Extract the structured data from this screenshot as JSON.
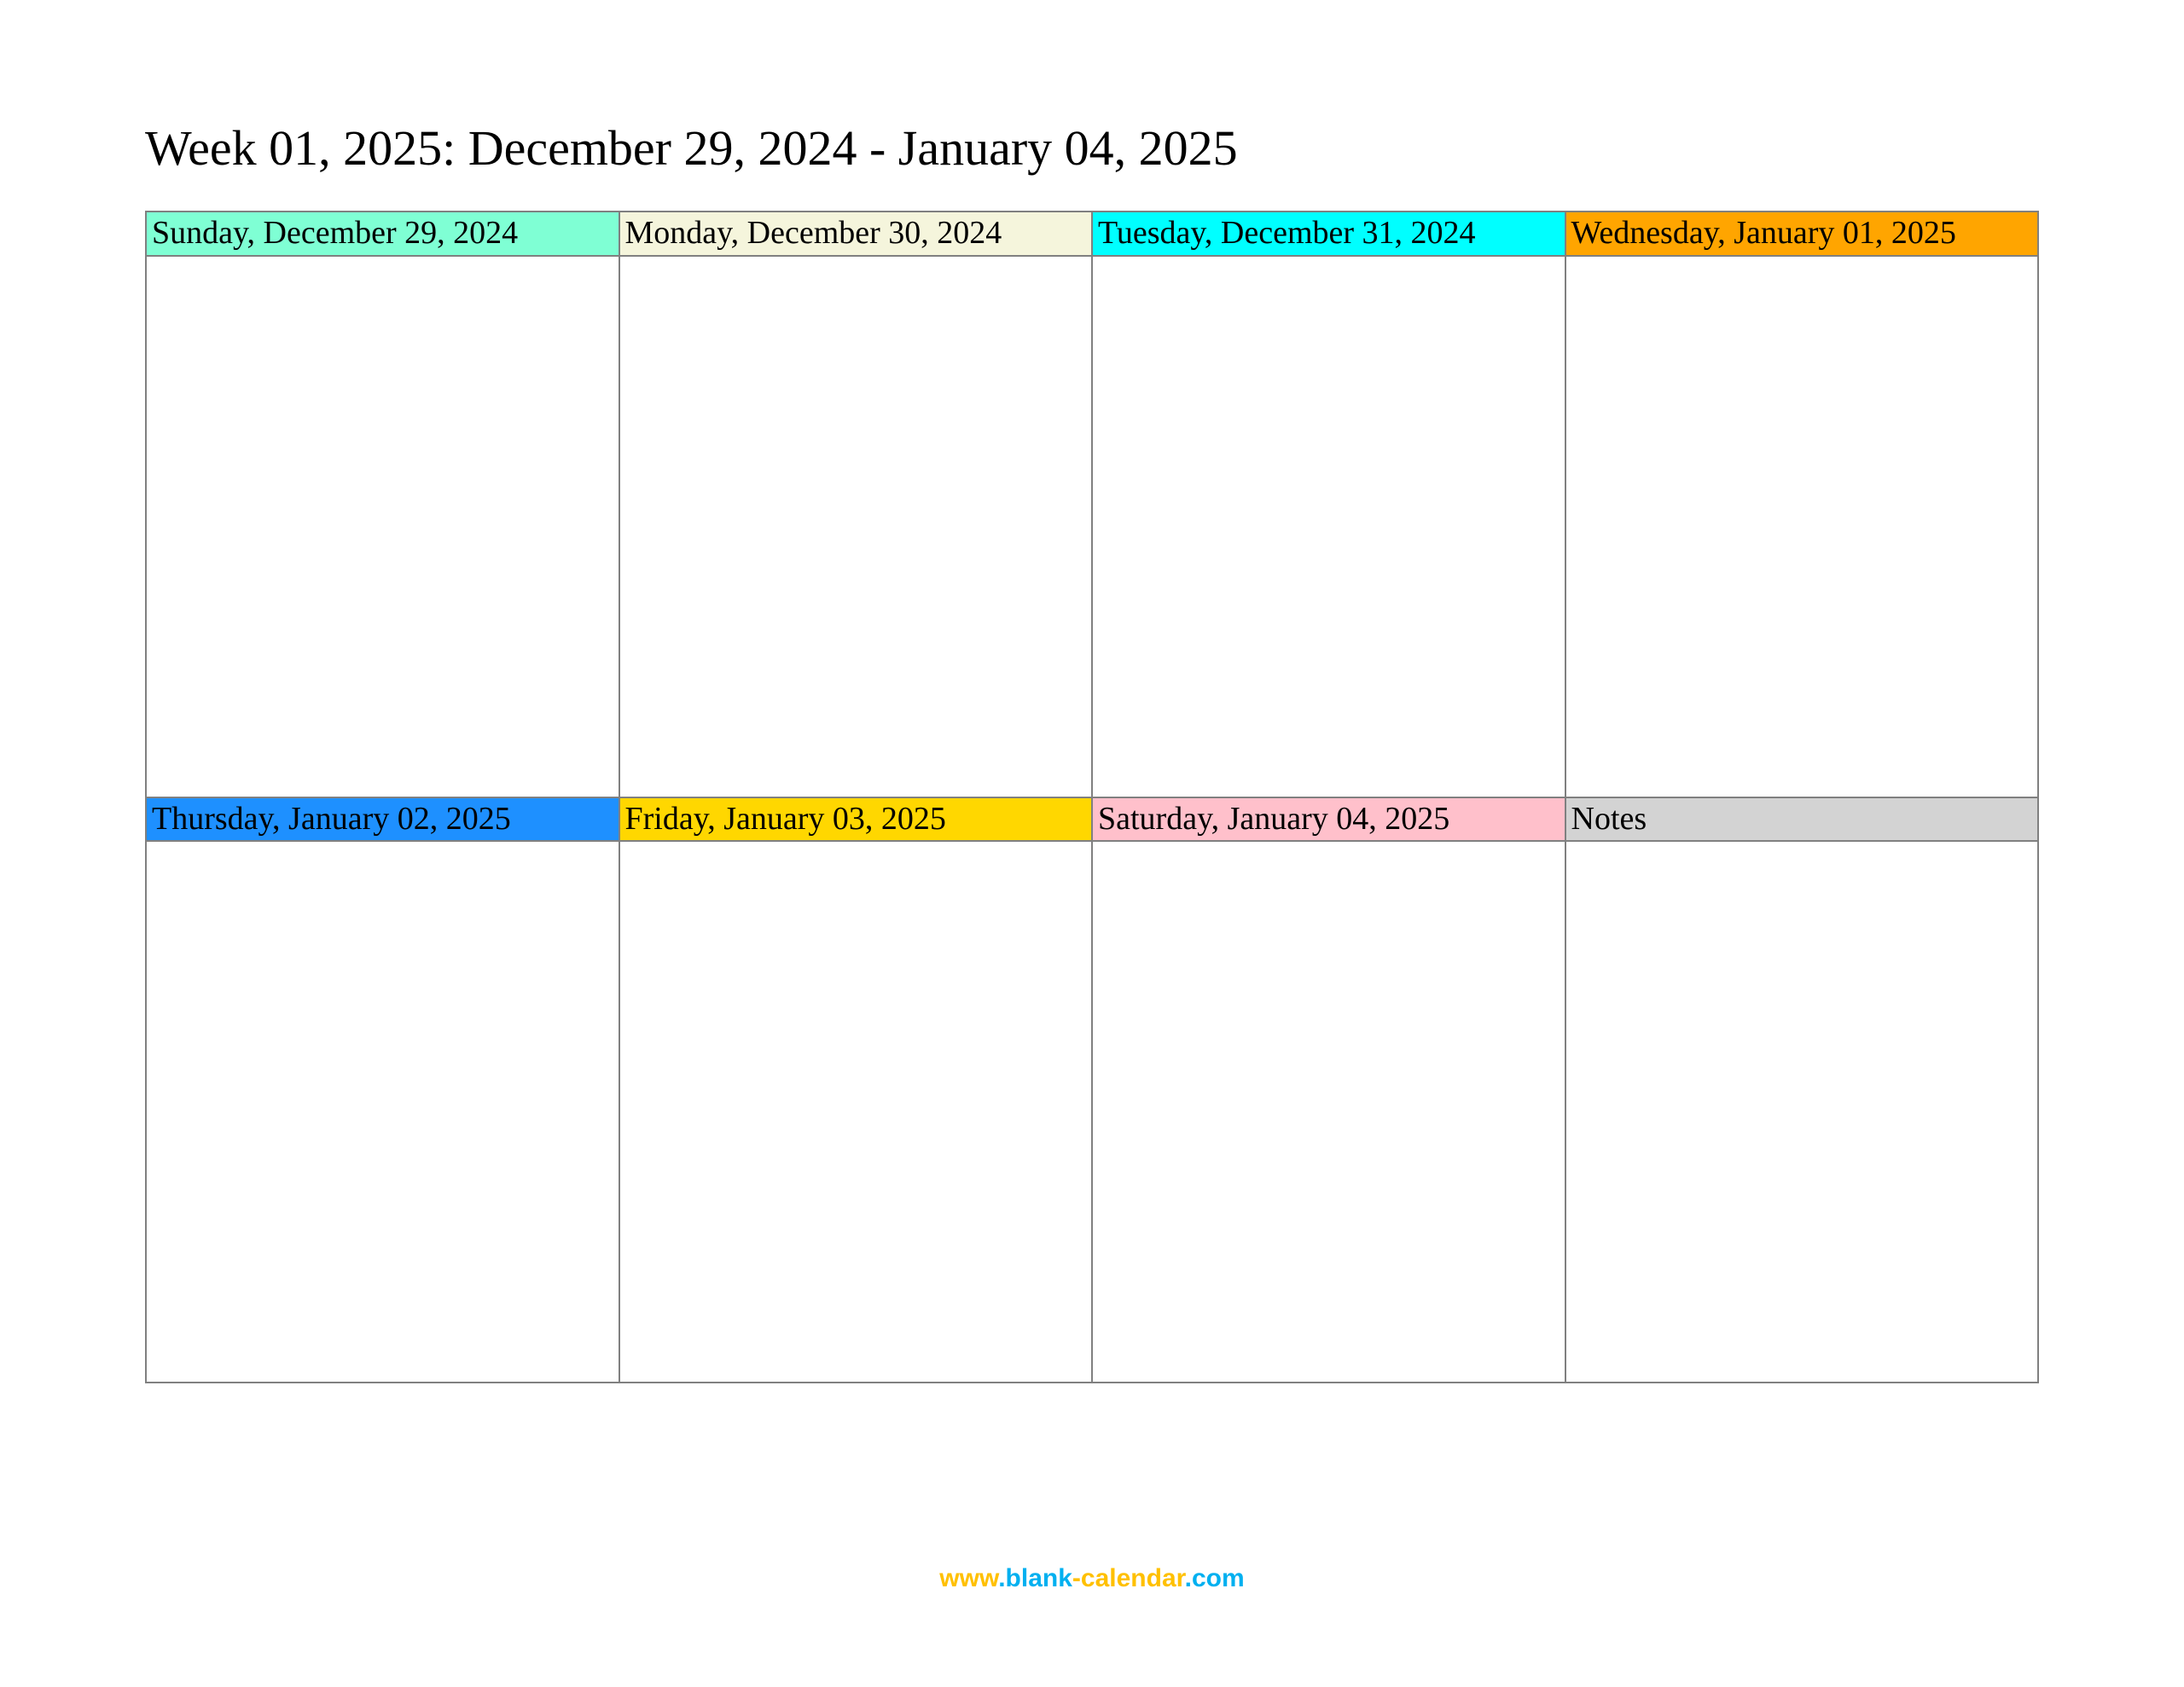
{
  "title": "Week 01, 2025: December 29, 2024 - January 04, 2025",
  "days": {
    "sunday": "Sunday, December 29, 2024",
    "monday": "Monday, December 30, 2024",
    "tuesday": "Tuesday, December 31, 2024",
    "wednesday": "Wednesday, January 01, 2025",
    "thursday": "Thursday, January 02, 2025",
    "friday": "Friday, January 03, 2025",
    "saturday": "Saturday, January 04, 2025",
    "notes": "Notes"
  },
  "footer": {
    "www": "www",
    "dot1": ".",
    "blank": "blank",
    "dash": "-",
    "cal": "calendar",
    "dot2": ".",
    "com": "com"
  }
}
